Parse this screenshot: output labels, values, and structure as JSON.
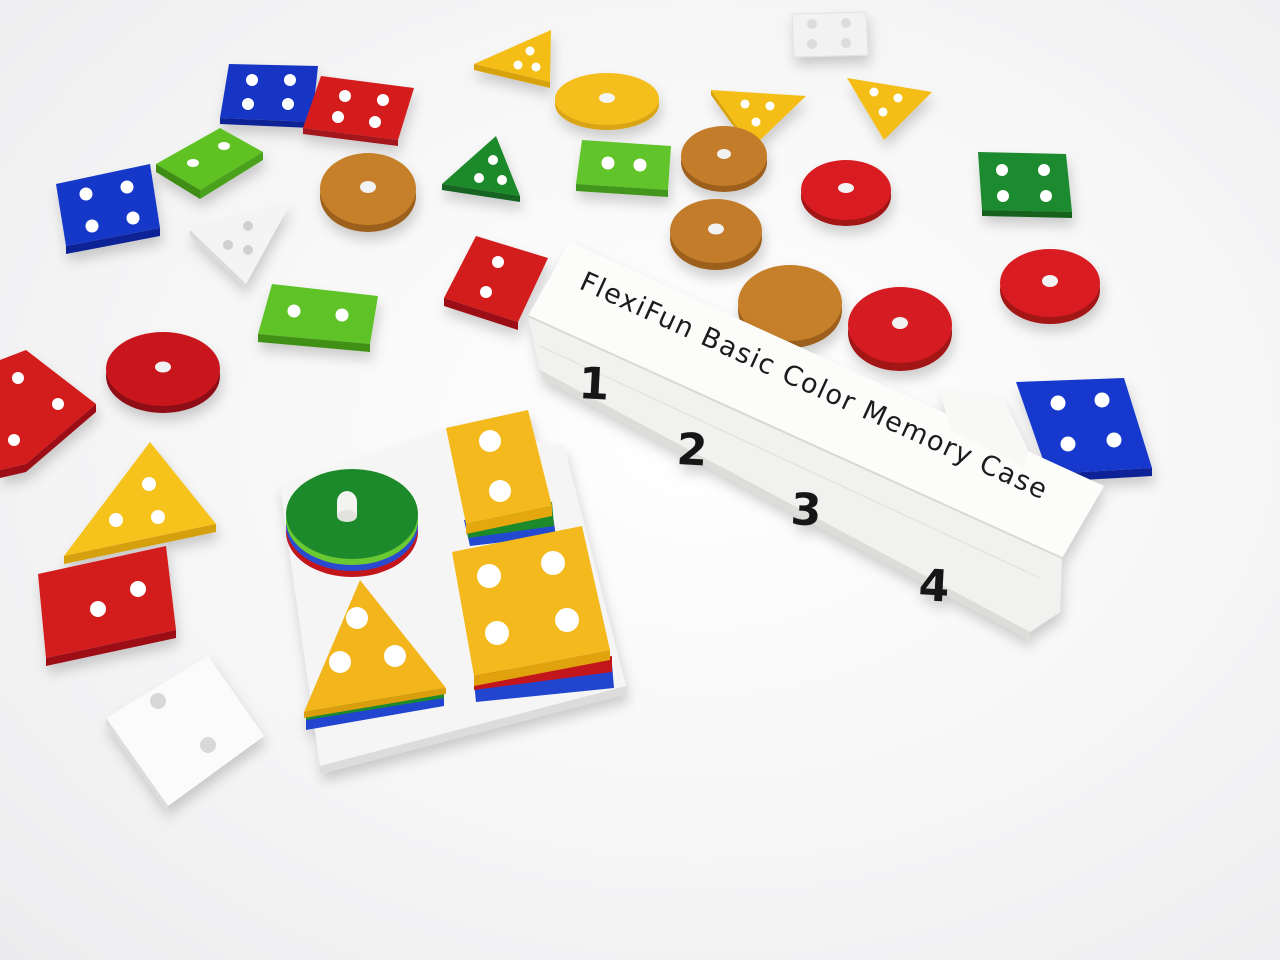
{
  "photo": {
    "case": {
      "label": "FlexiFun Basic Color Memory Case",
      "numbers": [
        "1",
        "2",
        "3",
        "4"
      ]
    },
    "colors": {
      "red": "#d21a1e",
      "blue": "#1236c8",
      "green": "#1f8a2a",
      "lime": "#5fbf23",
      "yellow": "#f6c21a",
      "brown": "#c27c28",
      "white": "#fafafa"
    }
  }
}
